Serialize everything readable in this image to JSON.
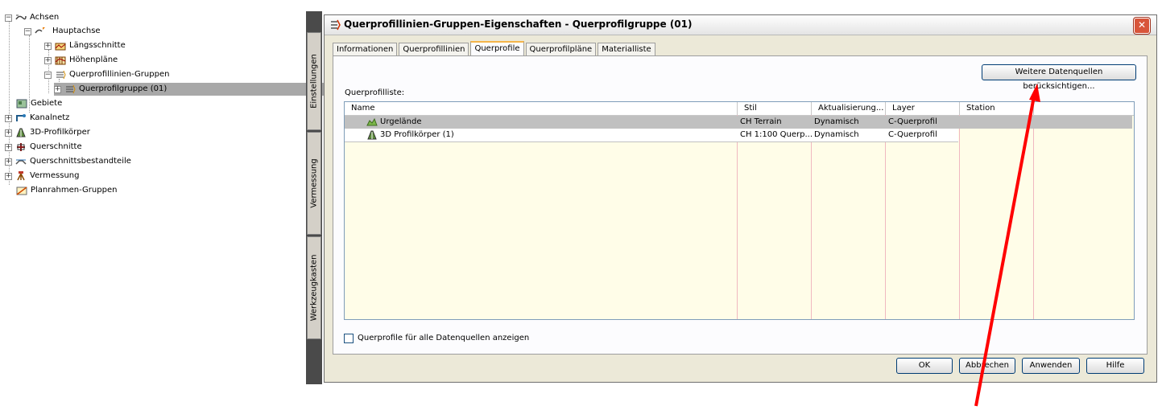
{
  "tree": {
    "items": [
      {
        "label": "Achsen"
      },
      {
        "label": "Hauptachse"
      },
      {
        "label": "Längsschnitte"
      },
      {
        "label": "Höhenpläne"
      },
      {
        "label": "Querprofillinien-Gruppen"
      },
      {
        "label": "Querprofilgruppe (01)"
      },
      {
        "label": "Gebiete"
      },
      {
        "label": "Kanalnetz"
      },
      {
        "label": "3D-Profilkörper"
      },
      {
        "label": "Querschnitte"
      },
      {
        "label": "Querschnittsbestandteile"
      },
      {
        "label": "Vermessung"
      },
      {
        "label": "Planrahmen-Gruppen"
      }
    ]
  },
  "palette": {
    "tabs": [
      "Einstellungen",
      "Vermessung",
      "Werkzeugkasten"
    ]
  },
  "dialog": {
    "title": "Querprofillinien-Gruppen-Eigenschaften - Querprofilgruppe (01)",
    "close_glyph": "✕",
    "tabs": [
      "Informationen",
      "Querprofillinien",
      "Querprofile",
      "Querprofilpläne",
      "Materialliste"
    ],
    "active_tab": "Querprofile",
    "more_sources_button": "Weitere Datenquellen berücksichtigen...",
    "list_label": "Querprofilliste:",
    "columns": [
      "Name",
      "Stil",
      "Aktualisierung...",
      "Layer",
      "Station"
    ],
    "rows": [
      {
        "name": "Urgelände",
        "stil": "CH Terrain",
        "aktualisierung": "Dynamisch",
        "layer": "C-Querprofil",
        "station": ""
      },
      {
        "name": "3D Profilkörper (1)",
        "stil": "CH 1:100 Querp...",
        "aktualisierung": "Dynamisch",
        "layer": "C-Querprofil",
        "station": ""
      }
    ],
    "checkbox_label": "Querprofile für alle Datenquellen anzeigen",
    "buttons": {
      "ok": "OK",
      "cancel": "Abbrechen",
      "apply": "Anwenden",
      "help": "Hilfe"
    }
  },
  "colors": {
    "annotation_arrow": "#ff0000",
    "dialog_bg": "#ece9d8",
    "grid_bg": "#fffde8",
    "selection": "#c0c0c0"
  }
}
